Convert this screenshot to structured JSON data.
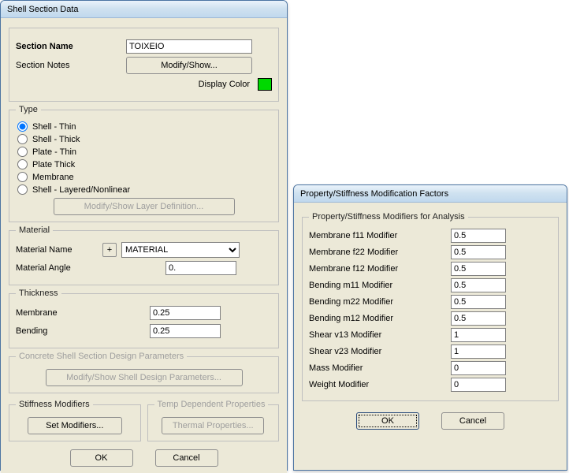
{
  "main": {
    "title": "Shell Section Data",
    "section_name_label": "Section Name",
    "section_name_value": "TOIXEIO",
    "section_notes_label": "Section Notes",
    "modify_show_btn": "Modify/Show...",
    "display_color_label": "Display Color",
    "type": {
      "legend": "Type",
      "selected": "thin",
      "options": {
        "thin": "Shell - Thin",
        "thick": "Shell - Thick",
        "plate_thin": "Plate - Thin",
        "plate_thick": "Plate Thick",
        "membrane": "Membrane",
        "layered": "Shell - Layered/Nonlinear"
      },
      "layer_btn": "Modify/Show Layer Definition..."
    },
    "material": {
      "legend": "Material",
      "name_label": "Material Name",
      "plus": "+",
      "name_value": "MATERIAL",
      "angle_label": "Material Angle",
      "angle_value": "0."
    },
    "thickness": {
      "legend": "Thickness",
      "membrane_label": "Membrane",
      "membrane_value": "0.25",
      "bending_label": "Bending",
      "bending_value": "0.25"
    },
    "design": {
      "legend": "Concrete Shell Section Design Parameters",
      "btn": "Modify/Show Shell Design Parameters..."
    },
    "stiffness": {
      "legend": "Stiffness Modifiers",
      "btn": "Set Modifiers..."
    },
    "temp": {
      "legend": "Temp Dependent Properties",
      "btn": "Thermal Properties..."
    },
    "ok": "OK",
    "cancel": "Cancel"
  },
  "modifiers": {
    "title": "Property/Stiffness Modification Factors",
    "legend": "Property/Stiffness Modifiers for Analysis",
    "rows": [
      {
        "label": "Membrane f11 Modifier",
        "value": "0.5"
      },
      {
        "label": "Membrane f22 Modifier",
        "value": "0.5"
      },
      {
        "label": "Membrane f12 Modifier",
        "value": "0.5"
      },
      {
        "label": "Bending  m11 Modifier",
        "value": "0.5"
      },
      {
        "label": "Bending  m22 Modifier",
        "value": "0.5"
      },
      {
        "label": "Bending  m12 Modifier",
        "value": "0.5"
      },
      {
        "label": "Shear  v13 Modifier",
        "value": "1"
      },
      {
        "label": "Shear  v23 Modifier",
        "value": "1"
      },
      {
        "label": "Mass Modifier",
        "value": "0"
      },
      {
        "label": "Weight Modifier",
        "value": "0"
      }
    ],
    "ok": "OK",
    "cancel": "Cancel"
  }
}
